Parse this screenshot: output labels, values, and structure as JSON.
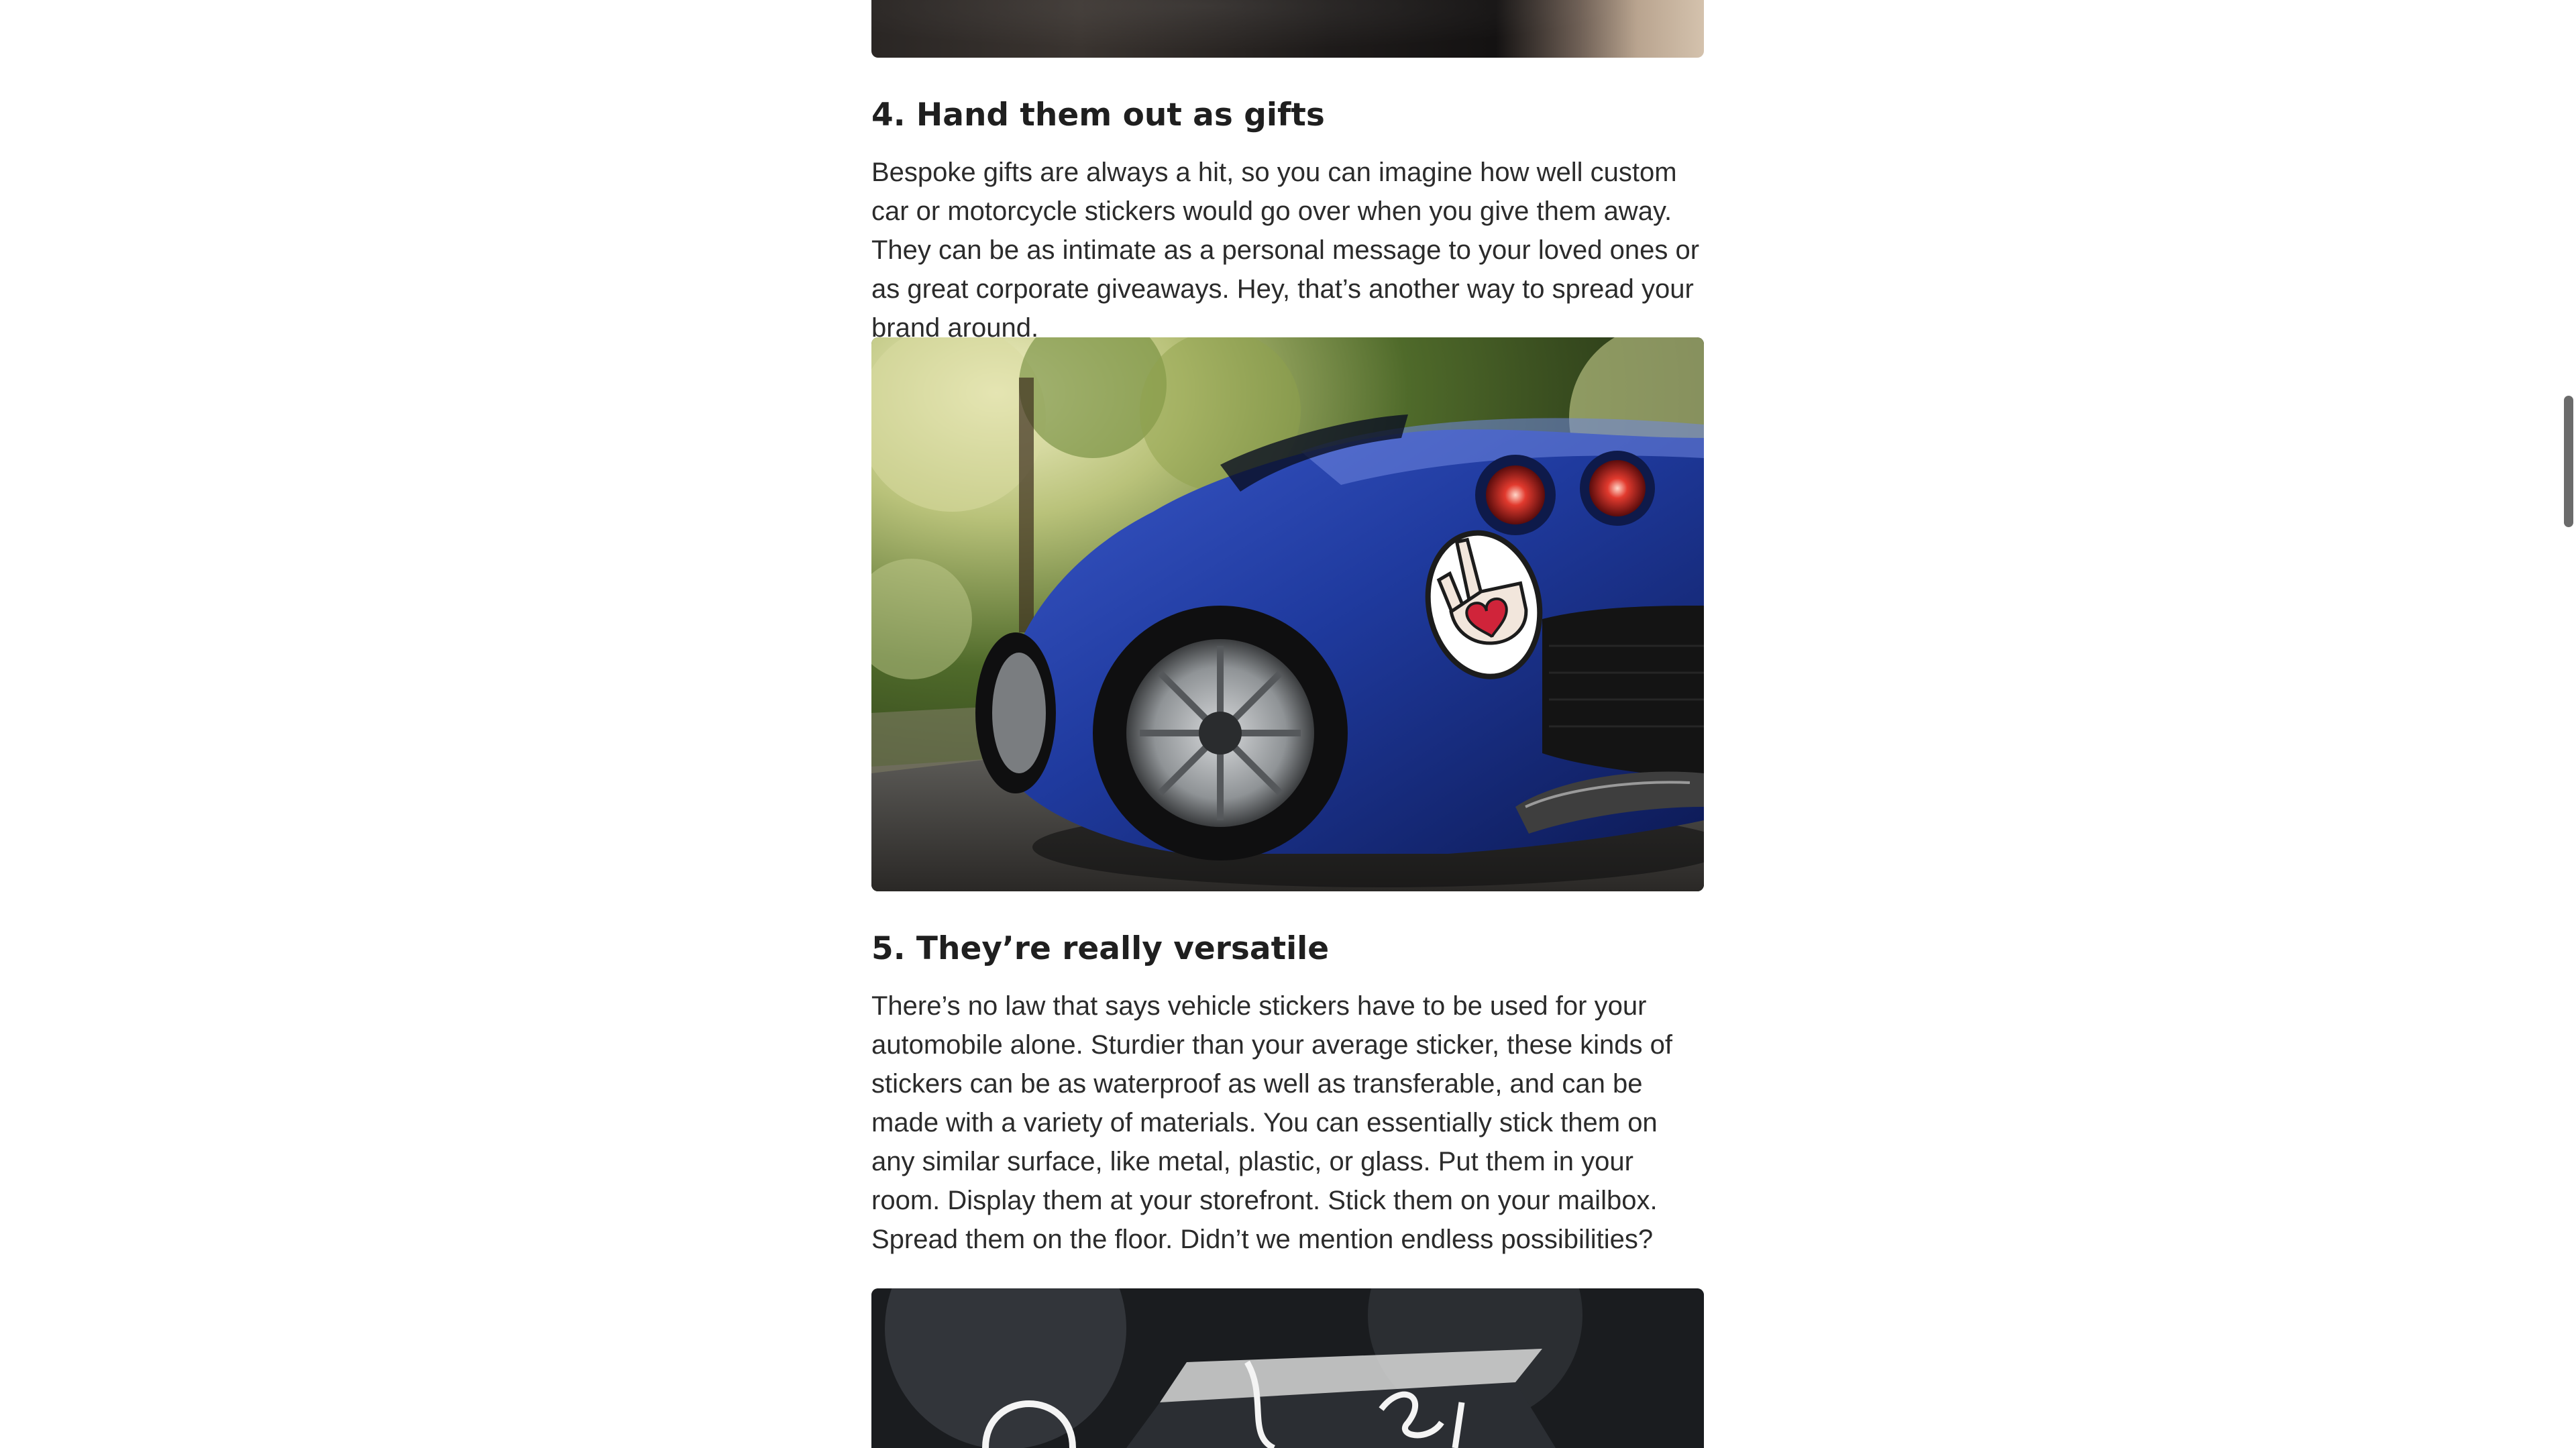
{
  "article": {
    "section4": {
      "heading": "4. Hand them out as gifts",
      "paragraph": "Bespoke gifts are always a hit, so you can imagine how well custom car or motorcycle stickers would go over when you give them away. They can be as intimate as a personal message to your loved ones or as great corporate giveaways. Hey, that’s another way to spread your brand around."
    },
    "section5": {
      "heading": "5. They’re really versatile",
      "paragraph": "There’s no law that says vehicle stickers have to be used for your automobile alone. Sturdier than your average sticker, these kinds of stickers can be as waterproof as well as transferable, and can be made with a variety of materials. You can essentially stick them on any similar surface, like metal, plastic, or glass. Put them in your room. Display them at your storefront. Stick them on your mailbox. Spread them on the floor. Didn’t we mention endless possibilities?"
    },
    "images": {
      "top": "photo",
      "car": "blue-sports-car-with-rock-hand-heart-sticker",
      "bottom": "dark-photo-with-white-lettering"
    }
  },
  "colors": {
    "car_blue": "#1f3a9e",
    "sticker_red": "#d0243a",
    "text": "#2b2b2b",
    "heading": "#1f1f1f",
    "scrollbar": "#6b6b6b"
  }
}
